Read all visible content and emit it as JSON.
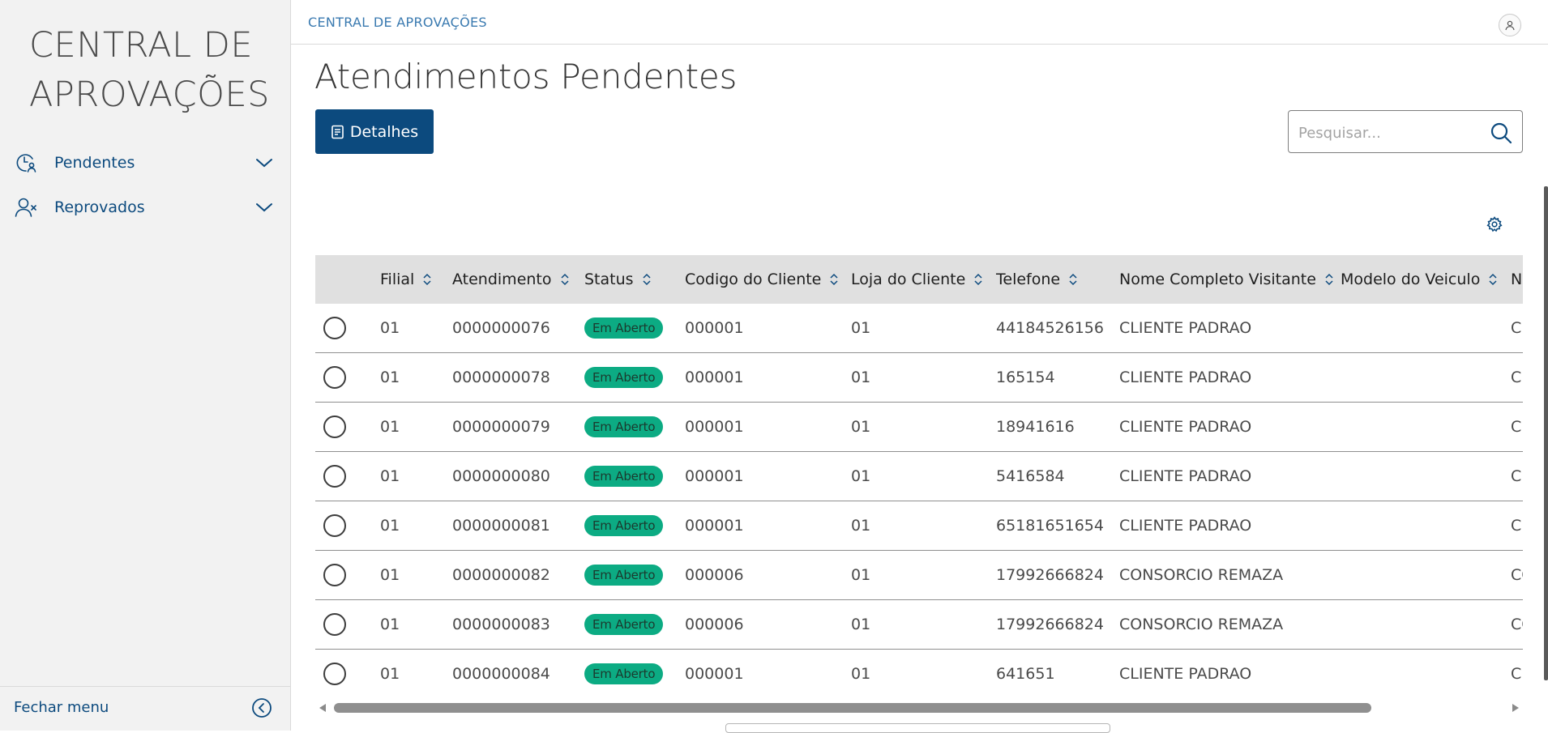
{
  "app": {
    "brand": "CENTRAL DE APROVAÇÕES"
  },
  "sidebar": {
    "items": [
      {
        "label": "Pendentes",
        "icon": "clock-user-icon"
      },
      {
        "label": "Reprovados",
        "icon": "user-x-icon"
      }
    ],
    "footer": {
      "label": "Fechar menu",
      "icon": "chevron-left-circle-icon"
    }
  },
  "header": {
    "breadcrumb": "CENTRAL DE APROVAÇÕES",
    "avatar_icon": "user-icon"
  },
  "main": {
    "title": "Atendimentos Pendentes",
    "details_button": "Detalhes",
    "search": {
      "placeholder": "Pesquisar...",
      "value": ""
    }
  },
  "table": {
    "columns": [
      "Filial",
      "Atendimento",
      "Status",
      "Codigo do Cliente",
      "Loja do Cliente",
      "Telefone",
      "Nome Completo Visitante",
      "Modelo do Veiculo",
      "No"
    ],
    "rows": [
      {
        "filial": "01",
        "atendimento": "0000000076",
        "status": "Em Aberto",
        "codigo": "000001",
        "loja": "01",
        "telefone": "44184526156",
        "nome": "CLIENTE PADRAO",
        "modelo": "",
        "extra": "CL"
      },
      {
        "filial": "01",
        "atendimento": "0000000078",
        "status": "Em Aberto",
        "codigo": "000001",
        "loja": "01",
        "telefone": "165154",
        "nome": "CLIENTE PADRAO",
        "modelo": "",
        "extra": "CL"
      },
      {
        "filial": "01",
        "atendimento": "0000000079",
        "status": "Em Aberto",
        "codigo": "000001",
        "loja": "01",
        "telefone": "18941616",
        "nome": "CLIENTE PADRAO",
        "modelo": "",
        "extra": "CL"
      },
      {
        "filial": "01",
        "atendimento": "0000000080",
        "status": "Em Aberto",
        "codigo": "000001",
        "loja": "01",
        "telefone": "5416584",
        "nome": "CLIENTE PADRAO",
        "modelo": "",
        "extra": "CL"
      },
      {
        "filial": "01",
        "atendimento": "0000000081",
        "status": "Em Aberto",
        "codigo": "000001",
        "loja": "01",
        "telefone": "65181651654",
        "nome": "CLIENTE PADRAO",
        "modelo": "",
        "extra": "CL"
      },
      {
        "filial": "01",
        "atendimento": "0000000082",
        "status": "Em Aberto",
        "codigo": "000006",
        "loja": "01",
        "telefone": "17992666824",
        "nome": "CONSORCIO REMAZA",
        "modelo": "",
        "extra": "CO"
      },
      {
        "filial": "01",
        "atendimento": "0000000083",
        "status": "Em Aberto",
        "codigo": "000006",
        "loja": "01",
        "telefone": "17992666824",
        "nome": "CONSORCIO REMAZA",
        "modelo": "",
        "extra": "CO"
      },
      {
        "filial": "01",
        "atendimento": "0000000084",
        "status": "Em Aberto",
        "codigo": "000001",
        "loja": "01",
        "telefone": "641651",
        "nome": "CLIENTE PADRAO",
        "modelo": "",
        "extra": "CL"
      }
    ]
  },
  "colors": {
    "primary": "#0c4a7e",
    "badge": "#0cab83",
    "sidebar_bg": "#f2f2f2",
    "header_row_bg": "#e0e0e0"
  }
}
